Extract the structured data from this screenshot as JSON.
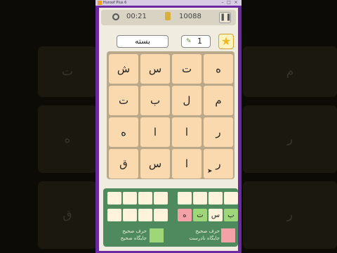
{
  "window": {
    "title": "Huroof Plus 6"
  },
  "topbar": {
    "timer": "00:21",
    "coins": "10088"
  },
  "word_box": "بسته",
  "hint_count": "1",
  "grid": [
    [
      "ه",
      "ت",
      "س",
      "ش"
    ],
    [
      "م",
      "ل",
      "ب",
      "ت"
    ],
    [
      "ر",
      "ا",
      "ا",
      "ه"
    ],
    [
      "ر",
      "ا",
      "س",
      "ق"
    ]
  ],
  "answer_slots": [
    "ب",
    "س",
    "ت",
    "ه"
  ],
  "legend": {
    "correct_letter": "حرف صحیح",
    "correct_position": "جایگاه صحیح",
    "wrong_position": "جایگاه نادرست",
    "green_color": "#9fd67a",
    "pink_color": "#f3a0a6"
  },
  "background_letters": {
    "left": [
      "ت",
      "ه",
      "ق"
    ],
    "right": [
      "م",
      "ر",
      "ر"
    ]
  }
}
